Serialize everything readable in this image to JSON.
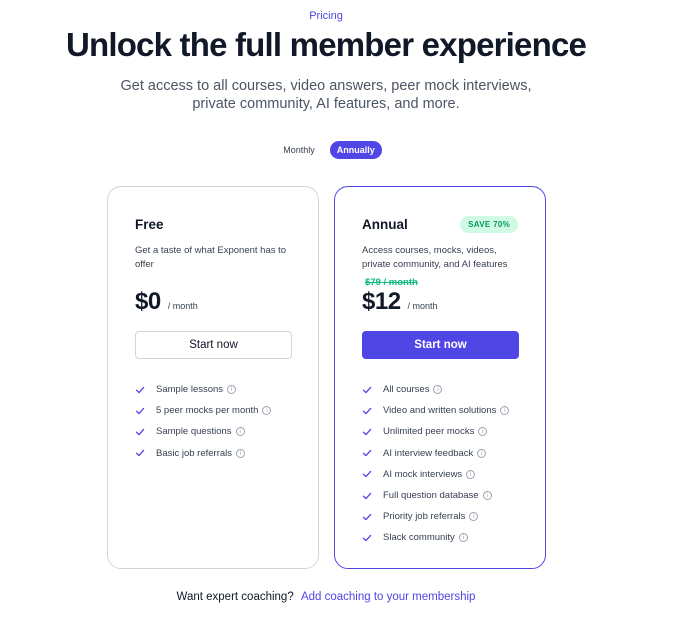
{
  "header": {
    "eyebrow": "Pricing",
    "title": "Unlock the full member experience",
    "subtitle_line1": "Get access to all courses, video answers, peer mock interviews,",
    "subtitle_line2": "private community, AI features, and more."
  },
  "billing_toggle": {
    "options": [
      "Monthly",
      "Annually"
    ],
    "selected": "Annually"
  },
  "plans": {
    "free": {
      "name": "Free",
      "description": "Get a taste of what Exponent has to offer",
      "price": "$0",
      "per": "/ month",
      "cta": "Start now",
      "features": [
        "Sample lessons",
        "5 peer mocks per month",
        "Sample questions",
        "Basic job referrals"
      ]
    },
    "annual": {
      "name": "Annual",
      "badge": "SAVE 70%",
      "description": "Access courses, mocks, videos, private community, and AI features",
      "old_price": "$79 / month",
      "price": "$12",
      "per": "/ month",
      "cta": "Start now",
      "features": [
        "All courses",
        "Video and written solutions",
        "Unlimited peer mocks",
        "AI interview feedback",
        "AI mock interviews",
        "Full question database",
        "Priority job referrals",
        "Slack community"
      ]
    }
  },
  "footer": {
    "prompt": "Want expert coaching?",
    "link": "Add coaching to your membership"
  },
  "colors": {
    "accent": "#4f46e5",
    "savings": "#10b981",
    "badge_bg": "#d1fae5"
  },
  "icons": {
    "feature": "check-icon",
    "info": "info-icon"
  }
}
